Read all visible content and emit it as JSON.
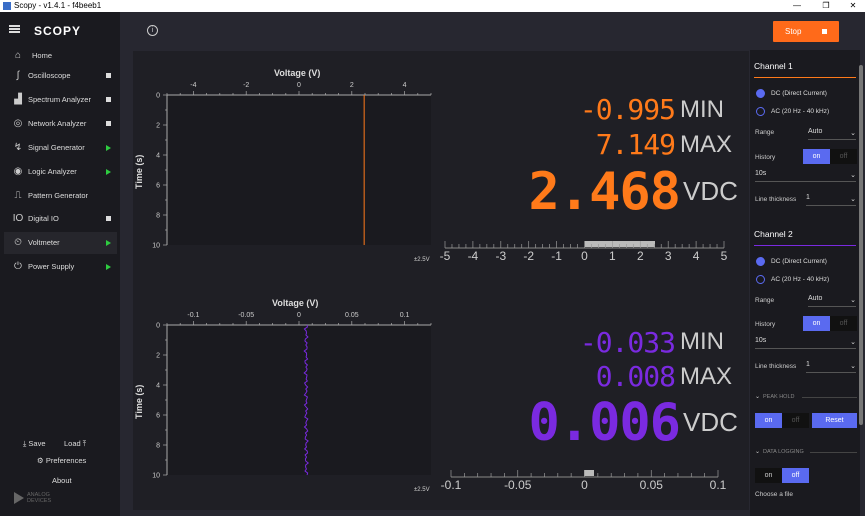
{
  "window": {
    "title": "Scopy - v1.4.1 - f4beeb1",
    "min": "—",
    "max": "❐",
    "close": "✕"
  },
  "app": {
    "logo": "SCOPY"
  },
  "sidebar": {
    "home": "Home",
    "items": [
      {
        "label": "Oscilloscope",
        "status": "square"
      },
      {
        "label": "Spectrum Analyzer",
        "status": "square"
      },
      {
        "label": "Network Analyzer",
        "status": "square"
      },
      {
        "label": "Signal Generator",
        "status": "play"
      },
      {
        "label": "Logic Analyzer",
        "status": "play"
      },
      {
        "label": "Pattern Generator",
        "status": ""
      },
      {
        "label": "Digital IO",
        "status": "square"
      },
      {
        "label": "Voltmeter",
        "status": "play"
      },
      {
        "label": "Power Supply",
        "status": "play"
      }
    ],
    "save": "Save",
    "load": "Load",
    "preferences": "Preferences",
    "about": "About",
    "brand_line1": "ANALOG",
    "brand_line2": "DEVICES"
  },
  "toolbar": {
    "stop_label": "Stop",
    "info": "i"
  },
  "channel1": {
    "histogram": {
      "title": "Voltage (V)",
      "x_ticks": [
        "-4",
        "-2",
        "0",
        "2",
        "4"
      ],
      "y_title": "Time (s)",
      "y_ticks": [
        "0",
        "2",
        "4",
        "6",
        "8",
        "10"
      ],
      "color": "#ff7a1a"
    },
    "min_value": "-0.995",
    "min_label": "MIN",
    "max_value": "7.149",
    "max_label": "MAX",
    "value": "2.468",
    "unit": "VDC",
    "range_label": "±2.5V",
    "scale_ticks": [
      "-5",
      "-4",
      "-3",
      "-2",
      "-1",
      "0",
      "1",
      "2",
      "3",
      "4",
      "5"
    ]
  },
  "channel2": {
    "histogram": {
      "title": "Voltage (V)",
      "x_ticks": [
        "-0.1",
        "-0.05",
        "0",
        "0.05",
        "0.1"
      ],
      "y_title": "Time (s)",
      "y_ticks": [
        "0",
        "2",
        "4",
        "6",
        "8",
        "10"
      ],
      "color": "#7a2ae0"
    },
    "min_value": "-0.033",
    "min_label": "MIN",
    "max_value": "0.008",
    "max_label": "MAX",
    "value": "0.006",
    "unit": "VDC",
    "range_label": "±2.5V",
    "scale_ticks": [
      "-0.1",
      "-0.05",
      "0",
      "0.05",
      "0.1"
    ]
  },
  "settings": {
    "ch1": {
      "title": "Channel 1",
      "dc": "DC (Direct Current)",
      "ac": "AC (20 Hz - 40 kHz)",
      "range_label": "Range",
      "range_value": "Auto",
      "history_label": "History",
      "on": "on",
      "off": "off",
      "history_time": "10s",
      "thickness_label": "Line thickness",
      "thickness_value": "1"
    },
    "ch2": {
      "title": "Channel 2",
      "dc": "DC (Direct Current)",
      "ac": "AC (20 Hz - 40 kHz)",
      "range_label": "Range",
      "range_value": "Auto",
      "history_label": "History",
      "on": "on",
      "off": "off",
      "history_time": "10s",
      "thickness_label": "Line thickness",
      "thickness_value": "1"
    },
    "peak_hold": "PEAK HOLD",
    "peak_on": "on",
    "peak_off": "off",
    "reset": "Reset",
    "data_logging": "DATA LOGGING",
    "log_on": "on",
    "log_off": "off",
    "choose_file": "Choose a file"
  },
  "colors": {
    "ch1": "#ff7a1a",
    "ch2": "#7a2ae0",
    "accent": "#5a6af0",
    "stop": "#ff6a1a"
  }
}
